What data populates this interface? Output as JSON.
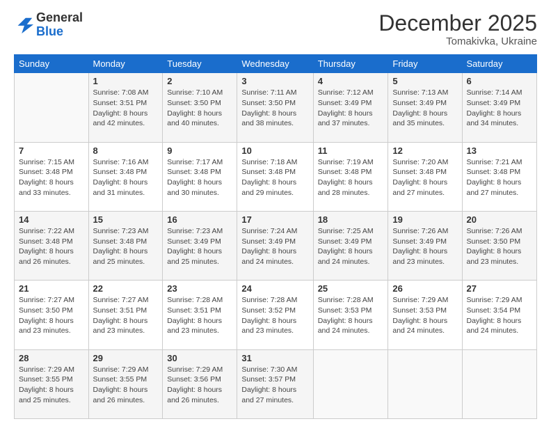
{
  "logo": {
    "general": "General",
    "blue": "Blue"
  },
  "header": {
    "month_title": "December 2025",
    "location": "Tomakivka, Ukraine"
  },
  "days_of_week": [
    "Sunday",
    "Monday",
    "Tuesday",
    "Wednesday",
    "Thursday",
    "Friday",
    "Saturday"
  ],
  "weeks": [
    [
      {
        "day": "",
        "detail": ""
      },
      {
        "day": "1",
        "detail": "Sunrise: 7:08 AM\nSunset: 3:51 PM\nDaylight: 8 hours\nand 42 minutes."
      },
      {
        "day": "2",
        "detail": "Sunrise: 7:10 AM\nSunset: 3:50 PM\nDaylight: 8 hours\nand 40 minutes."
      },
      {
        "day": "3",
        "detail": "Sunrise: 7:11 AM\nSunset: 3:50 PM\nDaylight: 8 hours\nand 38 minutes."
      },
      {
        "day": "4",
        "detail": "Sunrise: 7:12 AM\nSunset: 3:49 PM\nDaylight: 8 hours\nand 37 minutes."
      },
      {
        "day": "5",
        "detail": "Sunrise: 7:13 AM\nSunset: 3:49 PM\nDaylight: 8 hours\nand 35 minutes."
      },
      {
        "day": "6",
        "detail": "Sunrise: 7:14 AM\nSunset: 3:49 PM\nDaylight: 8 hours\nand 34 minutes."
      }
    ],
    [
      {
        "day": "7",
        "detail": "Sunrise: 7:15 AM\nSunset: 3:48 PM\nDaylight: 8 hours\nand 33 minutes."
      },
      {
        "day": "8",
        "detail": "Sunrise: 7:16 AM\nSunset: 3:48 PM\nDaylight: 8 hours\nand 31 minutes."
      },
      {
        "day": "9",
        "detail": "Sunrise: 7:17 AM\nSunset: 3:48 PM\nDaylight: 8 hours\nand 30 minutes."
      },
      {
        "day": "10",
        "detail": "Sunrise: 7:18 AM\nSunset: 3:48 PM\nDaylight: 8 hours\nand 29 minutes."
      },
      {
        "day": "11",
        "detail": "Sunrise: 7:19 AM\nSunset: 3:48 PM\nDaylight: 8 hours\nand 28 minutes."
      },
      {
        "day": "12",
        "detail": "Sunrise: 7:20 AM\nSunset: 3:48 PM\nDaylight: 8 hours\nand 27 minutes."
      },
      {
        "day": "13",
        "detail": "Sunrise: 7:21 AM\nSunset: 3:48 PM\nDaylight: 8 hours\nand 27 minutes."
      }
    ],
    [
      {
        "day": "14",
        "detail": "Sunrise: 7:22 AM\nSunset: 3:48 PM\nDaylight: 8 hours\nand 26 minutes."
      },
      {
        "day": "15",
        "detail": "Sunrise: 7:23 AM\nSunset: 3:48 PM\nDaylight: 8 hours\nand 25 minutes."
      },
      {
        "day": "16",
        "detail": "Sunrise: 7:23 AM\nSunset: 3:49 PM\nDaylight: 8 hours\nand 25 minutes."
      },
      {
        "day": "17",
        "detail": "Sunrise: 7:24 AM\nSunset: 3:49 PM\nDaylight: 8 hours\nand 24 minutes."
      },
      {
        "day": "18",
        "detail": "Sunrise: 7:25 AM\nSunset: 3:49 PM\nDaylight: 8 hours\nand 24 minutes."
      },
      {
        "day": "19",
        "detail": "Sunrise: 7:26 AM\nSunset: 3:49 PM\nDaylight: 8 hours\nand 23 minutes."
      },
      {
        "day": "20",
        "detail": "Sunrise: 7:26 AM\nSunset: 3:50 PM\nDaylight: 8 hours\nand 23 minutes."
      }
    ],
    [
      {
        "day": "21",
        "detail": "Sunrise: 7:27 AM\nSunset: 3:50 PM\nDaylight: 8 hours\nand 23 minutes."
      },
      {
        "day": "22",
        "detail": "Sunrise: 7:27 AM\nSunset: 3:51 PM\nDaylight: 8 hours\nand 23 minutes."
      },
      {
        "day": "23",
        "detail": "Sunrise: 7:28 AM\nSunset: 3:51 PM\nDaylight: 8 hours\nand 23 minutes."
      },
      {
        "day": "24",
        "detail": "Sunrise: 7:28 AM\nSunset: 3:52 PM\nDaylight: 8 hours\nand 23 minutes."
      },
      {
        "day": "25",
        "detail": "Sunrise: 7:28 AM\nSunset: 3:53 PM\nDaylight: 8 hours\nand 24 minutes."
      },
      {
        "day": "26",
        "detail": "Sunrise: 7:29 AM\nSunset: 3:53 PM\nDaylight: 8 hours\nand 24 minutes."
      },
      {
        "day": "27",
        "detail": "Sunrise: 7:29 AM\nSunset: 3:54 PM\nDaylight: 8 hours\nand 24 minutes."
      }
    ],
    [
      {
        "day": "28",
        "detail": "Sunrise: 7:29 AM\nSunset: 3:55 PM\nDaylight: 8 hours\nand 25 minutes."
      },
      {
        "day": "29",
        "detail": "Sunrise: 7:29 AM\nSunset: 3:55 PM\nDaylight: 8 hours\nand 26 minutes."
      },
      {
        "day": "30",
        "detail": "Sunrise: 7:29 AM\nSunset: 3:56 PM\nDaylight: 8 hours\nand 26 minutes."
      },
      {
        "day": "31",
        "detail": "Sunrise: 7:30 AM\nSunset: 3:57 PM\nDaylight: 8 hours\nand 27 minutes."
      },
      {
        "day": "",
        "detail": ""
      },
      {
        "day": "",
        "detail": ""
      },
      {
        "day": "",
        "detail": ""
      }
    ]
  ]
}
